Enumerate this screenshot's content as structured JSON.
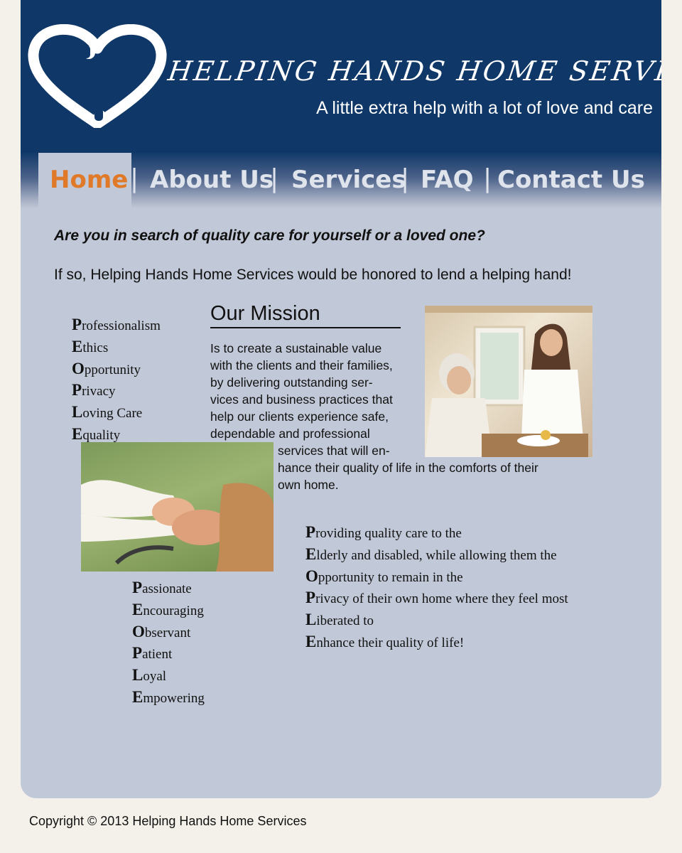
{
  "header": {
    "title": "HELPING HANDS HOME SERVICES",
    "tagline": "A little extra help with a lot of love and care",
    "logo_icon": "heart-hands-icon"
  },
  "nav": {
    "items": [
      {
        "label": "Home",
        "active": true
      },
      {
        "label": "About Us",
        "active": false
      },
      {
        "label": "Services",
        "active": false
      },
      {
        "label": "FAQ",
        "active": false
      },
      {
        "label": "Contact Us",
        "active": false
      }
    ],
    "separator": "|",
    "active_color": "#e07a28"
  },
  "main": {
    "question": "Are you in search of quality care for yourself or a loved one?",
    "intro": "If so, Helping Hands Home Services would be honored to lend a helping hand!",
    "values_list": [
      {
        "cap": "P",
        "rest": "rofessionalism"
      },
      {
        "cap": "E",
        "rest": "thics"
      },
      {
        "cap": "O",
        "rest": "pportunity"
      },
      {
        "cap": "P",
        "rest": "rivacy"
      },
      {
        "cap": "L",
        "rest": "oving Care"
      },
      {
        "cap": "E",
        "rest": "quality"
      }
    ],
    "mission": {
      "title": "Our Mission",
      "lines": [
        "Is to create a sustainable value",
        "with the clients and their families,",
        "by delivering outstanding ser-",
        "vices and business practices that",
        "help our clients experience safe,",
        "dependable and professional",
        "services that will en-",
        "hance their quality of life in the comforts of their",
        "own home."
      ]
    },
    "traits_list": [
      {
        "cap": "P",
        "rest": "assionate"
      },
      {
        "cap": "E",
        "rest": "ncouraging"
      },
      {
        "cap": "O",
        "rest": "bservant"
      },
      {
        "cap": "P",
        "rest": "atient"
      },
      {
        "cap": "L",
        "rest": "oyal"
      },
      {
        "cap": "E",
        "rest": "mpowering"
      }
    ],
    "people_list": [
      {
        "cap": "P",
        "rest": "roviding quality care to the"
      },
      {
        "cap": "E",
        "rest": "lderly and disabled, while allowing them the"
      },
      {
        "cap": "O",
        "rest": "pportunity to remain in the"
      },
      {
        "cap": "P",
        "rest": "rivacy of their own home where they feel most"
      },
      {
        "cap": "L",
        "rest": "iberated to"
      },
      {
        "cap": "E",
        "rest": "nhance their quality of life!"
      }
    ]
  },
  "footer": {
    "copyright": "Copyright © 2013 Helping Hands Home Services"
  }
}
